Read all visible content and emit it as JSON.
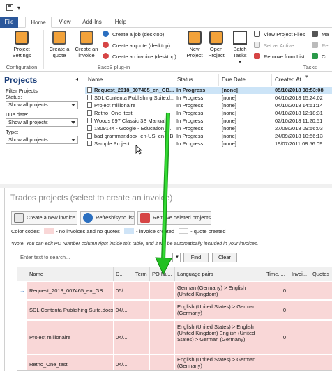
{
  "quick_access": {
    "save_icon": "save-icon",
    "customize_icon": "customize-icon"
  },
  "tabs": [
    "File",
    "Home",
    "View",
    "Add-Ins",
    "Help"
  ],
  "ribbon": {
    "project_settings": "Project Settings",
    "configuration_group": "Configuration",
    "create_quote": "Create a quote",
    "create_invoice": "Create an invoice",
    "create_job_desktop": "Create a job (desktop)",
    "create_quote_desktop": "Create a quote (desktop)",
    "create_invoice_desktop": "Create an invoice (desktop)",
    "baccs_group": "BaccS plug-in",
    "new_project": "New Project",
    "open_project": "Open Project",
    "batch_tasks": "Batch Tasks",
    "batch_tasks_arrow": "▾",
    "view_project_files": "View Project Files",
    "set_as_active": "Set as Active",
    "remove_from_list": "Remove from List",
    "tasks_group": "Tasks",
    "ma": "Ma",
    "re": "Re",
    "cr": "Cr"
  },
  "projects_pane": {
    "title": "Projects",
    "filter_projects": "Filter Projects",
    "status_label": "Status:",
    "status_value": "Show all projects",
    "due_date_label": "Due date:",
    "due_date_value": "Show all projects",
    "type_label": "Type:",
    "type_value": "Show all projects"
  },
  "project_list": {
    "columns": [
      "Name",
      "Status",
      "Due Date",
      "Created At"
    ],
    "rows": [
      {
        "name": "Request_2018_007465_en_GB...",
        "status": "In Progress",
        "due": "[none]",
        "created": "05/10/2018 08:53:08"
      },
      {
        "name": "SDL Contenta Publishing Suite.d...",
        "status": "In Progress",
        "due": "[none]",
        "created": "04/10/2018 15:24:02"
      },
      {
        "name": "Project millionaire",
        "status": "In Progress",
        "due": "[none]",
        "created": "04/10/2018 14:51:14"
      },
      {
        "name": "Retno_One_test",
        "status": "In Progress",
        "due": "[none]",
        "created": "04/10/2018 12:18:31"
      },
      {
        "name": "Woods 697 Classic 3S Manual",
        "status": "In Progress",
        "due": "[none]",
        "created": "02/10/2018 11:20:51"
      },
      {
        "name": "1809144 - Google - Education_...",
        "status": "In Progress",
        "due": "[none]",
        "created": "27/09/2018 09:56:03"
      },
      {
        "name": "bad grammar.docx_en-US_en-GB",
        "status": "In Progress",
        "due": "[none]",
        "created": "24/09/2018 10:56:13"
      },
      {
        "name": "Sample Project",
        "status": "In Progress",
        "due": "[none]",
        "created": "19/07/2011 08:56:09"
      }
    ]
  },
  "trados_panel": {
    "title": "Trados projects (select to create an invoice)",
    "create_invoice": "Create a new invoice",
    "refresh": "Refresh/sync list",
    "remove_deleted": "Remove deleted projects",
    "color_codes_label": "Color codes:",
    "legend_no_invoices": "- no invoices and no quotes",
    "legend_invoice_created": "- invoice created",
    "legend_quote_created": "- quote created",
    "note": "*Note. You can edit PO Number column right inside this table, and it will be automatically included in your invoices.",
    "search_placeholder": "Enter text to search...",
    "find": "Find",
    "clear": "Clear",
    "columns": [
      "Name",
      "D...",
      "Term",
      "PO Nu...",
      "Language pairs",
      "Time, ...",
      "Invoi...",
      "Quotes"
    ],
    "rows": [
      {
        "name": "Request_2018_007465_en_GB...",
        "date": "05/...",
        "term": "",
        "po": "",
        "lang": "German (Germany) > English (United Kingdom)",
        "time": "0",
        "invoices": "",
        "quotes": ""
      },
      {
        "name": "SDL Contenta Publishing Suite.docx",
        "date": "04/...",
        "term": "",
        "po": "",
        "lang": "English (United States) > German (Germany)",
        "time": "0",
        "invoices": "",
        "quotes": ""
      },
      {
        "name": "Project millionaire",
        "date": "04/...",
        "term": "",
        "po": "",
        "lang": "English (United States) > English (United Kingdom) English (United States) > German (Germany)",
        "time": "0",
        "invoices": "",
        "quotes": ""
      },
      {
        "name": "Retno_One_test",
        "date": "04/...",
        "term": "",
        "po": "",
        "lang": "English (United States) > German (Germany)",
        "time": "",
        "invoices": "",
        "quotes": ""
      }
    ]
  },
  "colors": {
    "accent": "#2b579a",
    "pink": "#f9d7d7",
    "blue": "#cfe4f7",
    "green_arrow": "#22c022",
    "selected": "#cce4f7"
  }
}
